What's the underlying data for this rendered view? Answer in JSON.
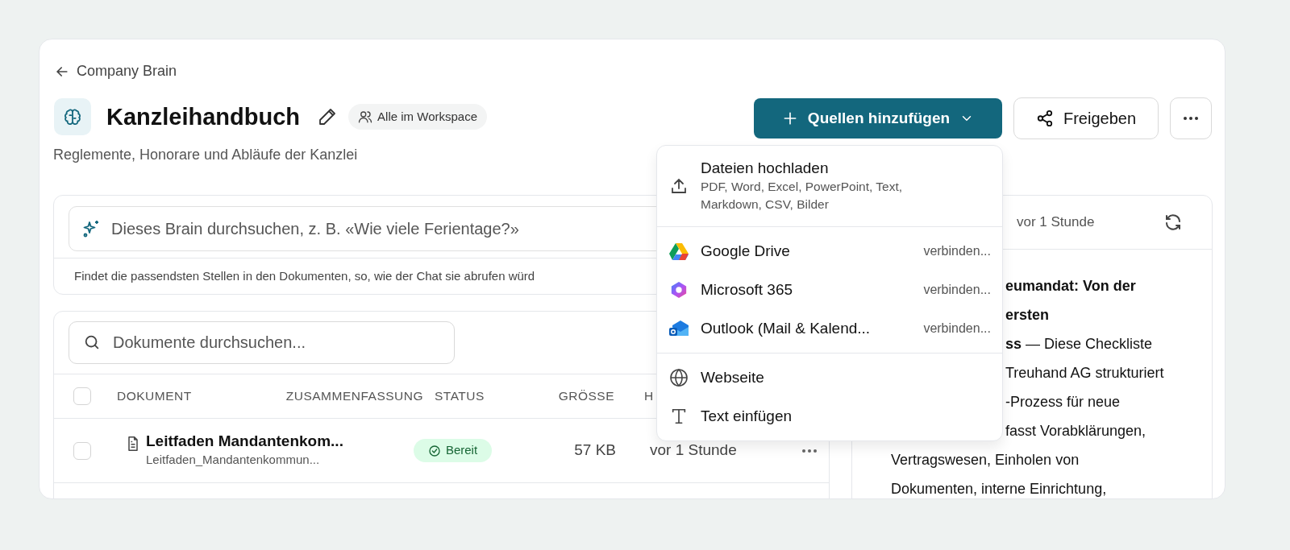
{
  "breadcrumb": {
    "label": "Company Brain"
  },
  "header": {
    "title": "Kanzleihandbuch",
    "visibility": "Alle im Workspace",
    "description": "Reglemente, Honorare und Abläufe der Kanzlei"
  },
  "actions": {
    "primary": "Quellen hinzufügen",
    "share": "Freigeben"
  },
  "brain_search": {
    "placeholder": "Dieses Brain durchsuchen, z. B. «Wie viele Ferientage?»",
    "hint": "Findet die passendsten Stellen in den Dokumenten, so, wie der Chat sie abrufen würd"
  },
  "documents": {
    "search_placeholder": "Dokumente durchsuchen...",
    "select_all": {
      "checked": false
    },
    "columns": [
      {
        "label": "DOKUMENT"
      },
      {
        "label": "ZUSAMMENFASSUNG"
      },
      {
        "label": "STATUS"
      },
      {
        "label": "GRÖSSE"
      },
      {
        "label": "H"
      }
    ],
    "rows": [
      {
        "checked": false,
        "title": "Leitfaden Mandantenkom...",
        "file": "Leitfaden_Mandantenkommun...",
        "status": "Bereit",
        "size": "57 KB",
        "modified": "vor 1 Stunde"
      }
    ]
  },
  "preview": {
    "updated": "vor 1 Stunde",
    "fragments": [
      "**eumandat: Von der**",
      "**ersten**",
      "**ss** — Diese Checkliste",
      "Treuhand AG strukturiert",
      "-Prozess für neue",
      "fasst Vorabklärungen,"
    ],
    "lines": [
      "Vertragswesen, Einholen von",
      "Dokumenten, interne Einrichtung,"
    ]
  },
  "sources_menu": {
    "sections": [
      {
        "items": [
          {
            "kind": "upload",
            "label": "Dateien hochladen",
            "description": "PDF, Word, Excel, PowerPoint, Text, Markdown, CSV, Bilder"
          }
        ]
      },
      {
        "items": [
          {
            "kind": "google-drive",
            "label": "Google Drive",
            "action": "verbinden..."
          },
          {
            "kind": "microsoft-365",
            "label": "Microsoft 365",
            "action": "verbinden..."
          },
          {
            "kind": "outlook",
            "label": "Outlook (Mail & Kalend...",
            "action": "verbinden..."
          }
        ]
      },
      {
        "items": [
          {
            "kind": "website",
            "label": "Webseite"
          },
          {
            "kind": "text",
            "label": "Text einfügen"
          }
        ]
      }
    ]
  }
}
